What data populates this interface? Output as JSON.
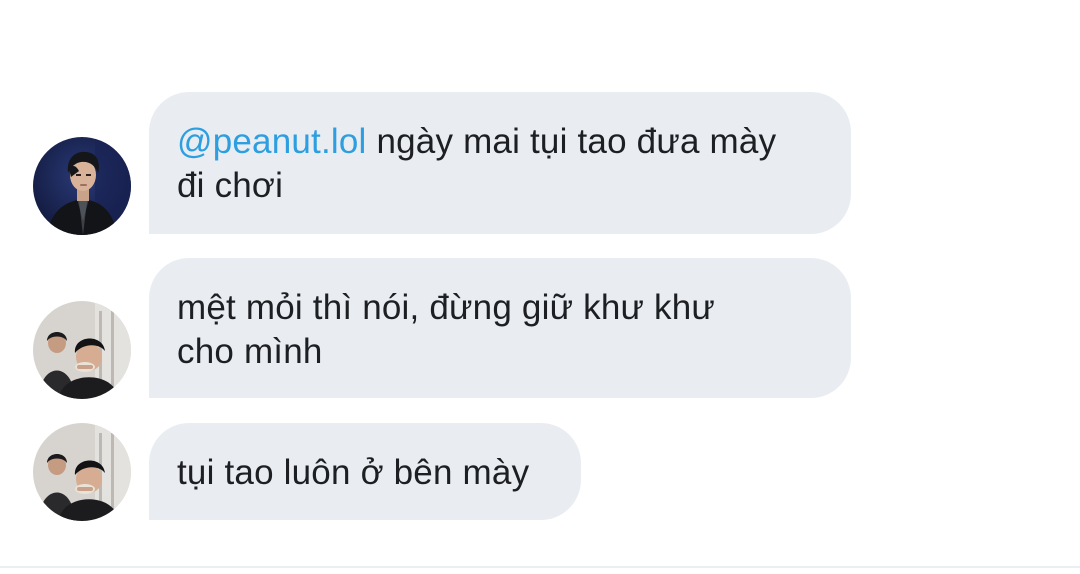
{
  "messages": [
    {
      "avatar": "avatar-photo-man-in-suit",
      "mention": "@peanut.lol",
      "line1_rest": " ngày mai tụi tao đưa mày",
      "line2": "đi chơi"
    },
    {
      "avatar": "avatar-photo-group-eating",
      "line1": "mệt mỏi thì nói, đừng giữ khư khư",
      "line2": "cho mình"
    },
    {
      "avatar": "avatar-photo-group-eating",
      "line1": "tụi tao luôn ở bên mày"
    }
  ],
  "colors": {
    "bubble_bg": "#e9edf2",
    "mention": "#2d9ee0",
    "text": "#1d1f22",
    "background": "#ffffff"
  }
}
